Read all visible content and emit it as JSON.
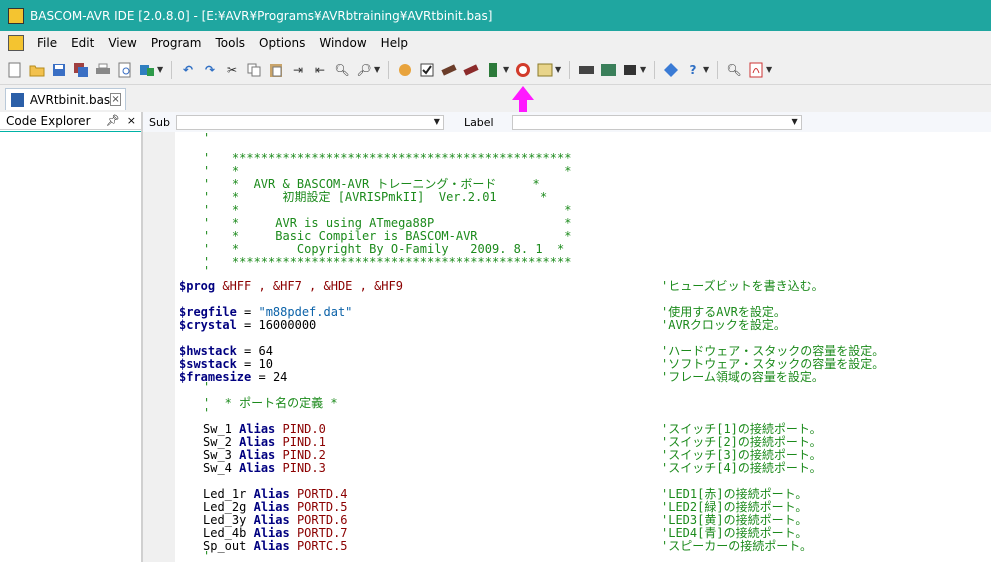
{
  "window": {
    "title": "BASCOM-AVR IDE [2.0.8.0] - [E:¥AVR¥Programs¥AVRbtraining¥AVRtbinit.bas]"
  },
  "menu": [
    "File",
    "Edit",
    "View",
    "Program",
    "Tools",
    "Options",
    "Window",
    "Help"
  ],
  "tab": {
    "label": "AVRtbinit.bas"
  },
  "explorer": {
    "title": "Code Explorer",
    "pin": "⬚",
    "close": "×"
  },
  "subbar": {
    "sub_label": "Sub",
    "sub_value": "",
    "label_label": "Label",
    "label_value": ""
  },
  "colors": {
    "titlebar": "#1fa6a0",
    "arrow": "#ff19ff",
    "keyword": "#000080",
    "comment": "#1b8a1b",
    "number": "#8b0000",
    "string": "#0b62a8"
  },
  "code": {
    "c0": "'",
    "c1": "'   ***********************************************",
    "c2": "'   *                                             *",
    "c3": "'   *  AVR & BASCOM-AVR トレーニング・ボード     *",
    "c4": "'   *      初期設定 [AVRISPmkII]  Ver.2.01      *",
    "c5": "'   *                                             *",
    "c6": "'   *     AVR is using ATmega88P                  *",
    "c7": "'   *     Basic Compiler is BASCOM-AVR            *",
    "c8": "'   *        Copyright By O-Family   2009. 8. 1  *",
    "c9": "'   ***********************************************",
    "c10": "'",
    "prog_kw": "$prog",
    "prog_args": " &HFF , &HF7 , &HDE , &HF9",
    "prog_cmt": "'ヒューズビットを書き込む。",
    "regfile_kw": "$regfile",
    "regfile_eq": " = ",
    "regfile_val": "\"m88pdef.dat\"",
    "regfile_cmt": "'使用するAVRを設定。",
    "crystal_kw": "$crystal",
    "crystal_eq": " = ",
    "crystal_val": "16000000",
    "crystal_cmt": "'AVRクロックを設定。",
    "hw_kw": "$hwstack",
    "hw_eq": " = ",
    "hw_val": "64",
    "hw_cmt": "'ハードウェア・スタックの容量を設定。",
    "sw_kw": "$swstack",
    "sw_eq": " = ",
    "sw_val": "10",
    "sw_cmt": "'ソフトウェア・スタックの容量を設定。",
    "fs_kw": "$framesize",
    "fs_eq": " = ",
    "fs_val": "24",
    "fs_cmt": "'フレーム領域の容量を設定。",
    "c11": "'",
    "c12": "'  * ポート名の定義 *",
    "c13": "'",
    "sw1": "Sw_1",
    "sw1_val": "PIND.0",
    "sw1_cmt": "'スイッチ[1]の接続ポート。",
    "sw2": "Sw_2",
    "sw2_val": "PIND.1",
    "sw2_cmt": "'スイッチ[2]の接続ポート。",
    "sw3": "Sw_3",
    "sw3_val": "PIND.2",
    "sw3_cmt": "'スイッチ[3]の接続ポート。",
    "sw4": "Sw_4",
    "sw4_val": "PIND.3",
    "sw4_cmt": "'スイッチ[4]の接続ポート。",
    "alias": "Alias",
    "led1": "Led_1r",
    "led1_val": "PORTD.4",
    "led1_cmt": "'LED1[赤]の接続ポート。",
    "led2": "Led_2g",
    "led2_val": "PORTD.5",
    "led2_cmt": "'LED2[緑]の接続ポート。",
    "led3": "Led_3y",
    "led3_val": "PORTD.6",
    "led3_cmt": "'LED3[黄]の接続ポート。",
    "led4": "Led_4b",
    "led4_val": "PORTD.7",
    "led4_cmt": "'LED4[青]の接続ポート。",
    "spo": "Sp_out",
    "spo_val": "PORTC.5",
    "spo_cmt": "'スピーカーの接続ポート。",
    "c14": "'"
  },
  "toolbar_icons": [
    "new-file-icon",
    "open-file-icon",
    "save-icon",
    "save-all-icon",
    "print-icon",
    "print-preview-icon",
    "export-icon",
    "undo-icon",
    "redo-icon",
    "cut-icon",
    "copy-icon",
    "paste-icon",
    "indent-icon",
    "outdent-icon",
    "find-icon",
    "find-next-icon",
    "run-icon",
    "syntax-check-icon",
    "compile-icon",
    "program-chip-icon",
    "programmer-icon",
    "stop-icon",
    "simulator-icon",
    "terminal-icon",
    "lcd-designer-icon",
    "info-icon",
    "help-icon",
    "zoom-icon",
    "pdf-icon"
  ]
}
